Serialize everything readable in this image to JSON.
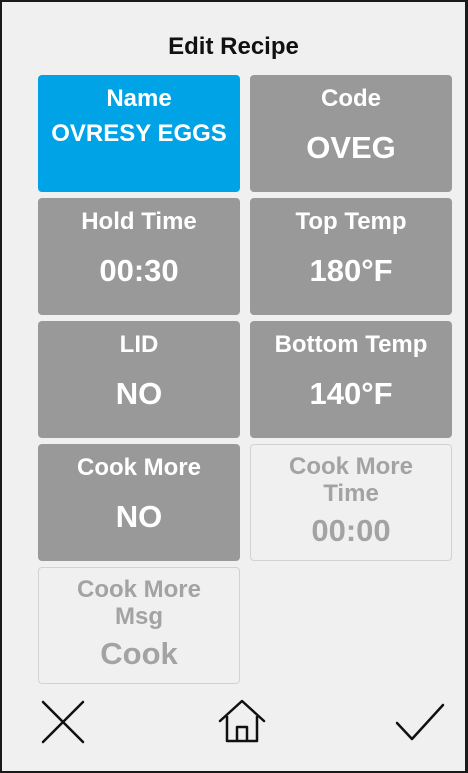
{
  "header": {
    "title": "Edit Recipe"
  },
  "fields": {
    "name": {
      "label": "Name",
      "value": "OVRESY EGGS"
    },
    "code": {
      "label": "Code",
      "value": "OVEG"
    },
    "hold_time": {
      "label": "Hold Time",
      "value": "00:30"
    },
    "top_temp": {
      "label": "Top Temp",
      "value": "180°F"
    },
    "lid": {
      "label": "LID",
      "value": "NO"
    },
    "bottom_temp": {
      "label": "Bottom Temp",
      "value": "140°F"
    },
    "cook_more": {
      "label": "Cook More",
      "value": "NO"
    },
    "cook_more_time": {
      "label_line1": "Cook More",
      "label_line2": "Time",
      "value": "00:00"
    },
    "cook_more_msg": {
      "label_line1": "Cook More",
      "label_line2": "Msg",
      "value": "Cook"
    }
  },
  "footer": {
    "cancel_icon": "close-icon",
    "home_icon": "home-icon",
    "confirm_icon": "checkmark-icon"
  },
  "colors": {
    "selected_tile": "#00a3e6",
    "enabled_tile": "#999999",
    "disabled_text": "#a3a3a3",
    "background": "#f0f0f0"
  }
}
